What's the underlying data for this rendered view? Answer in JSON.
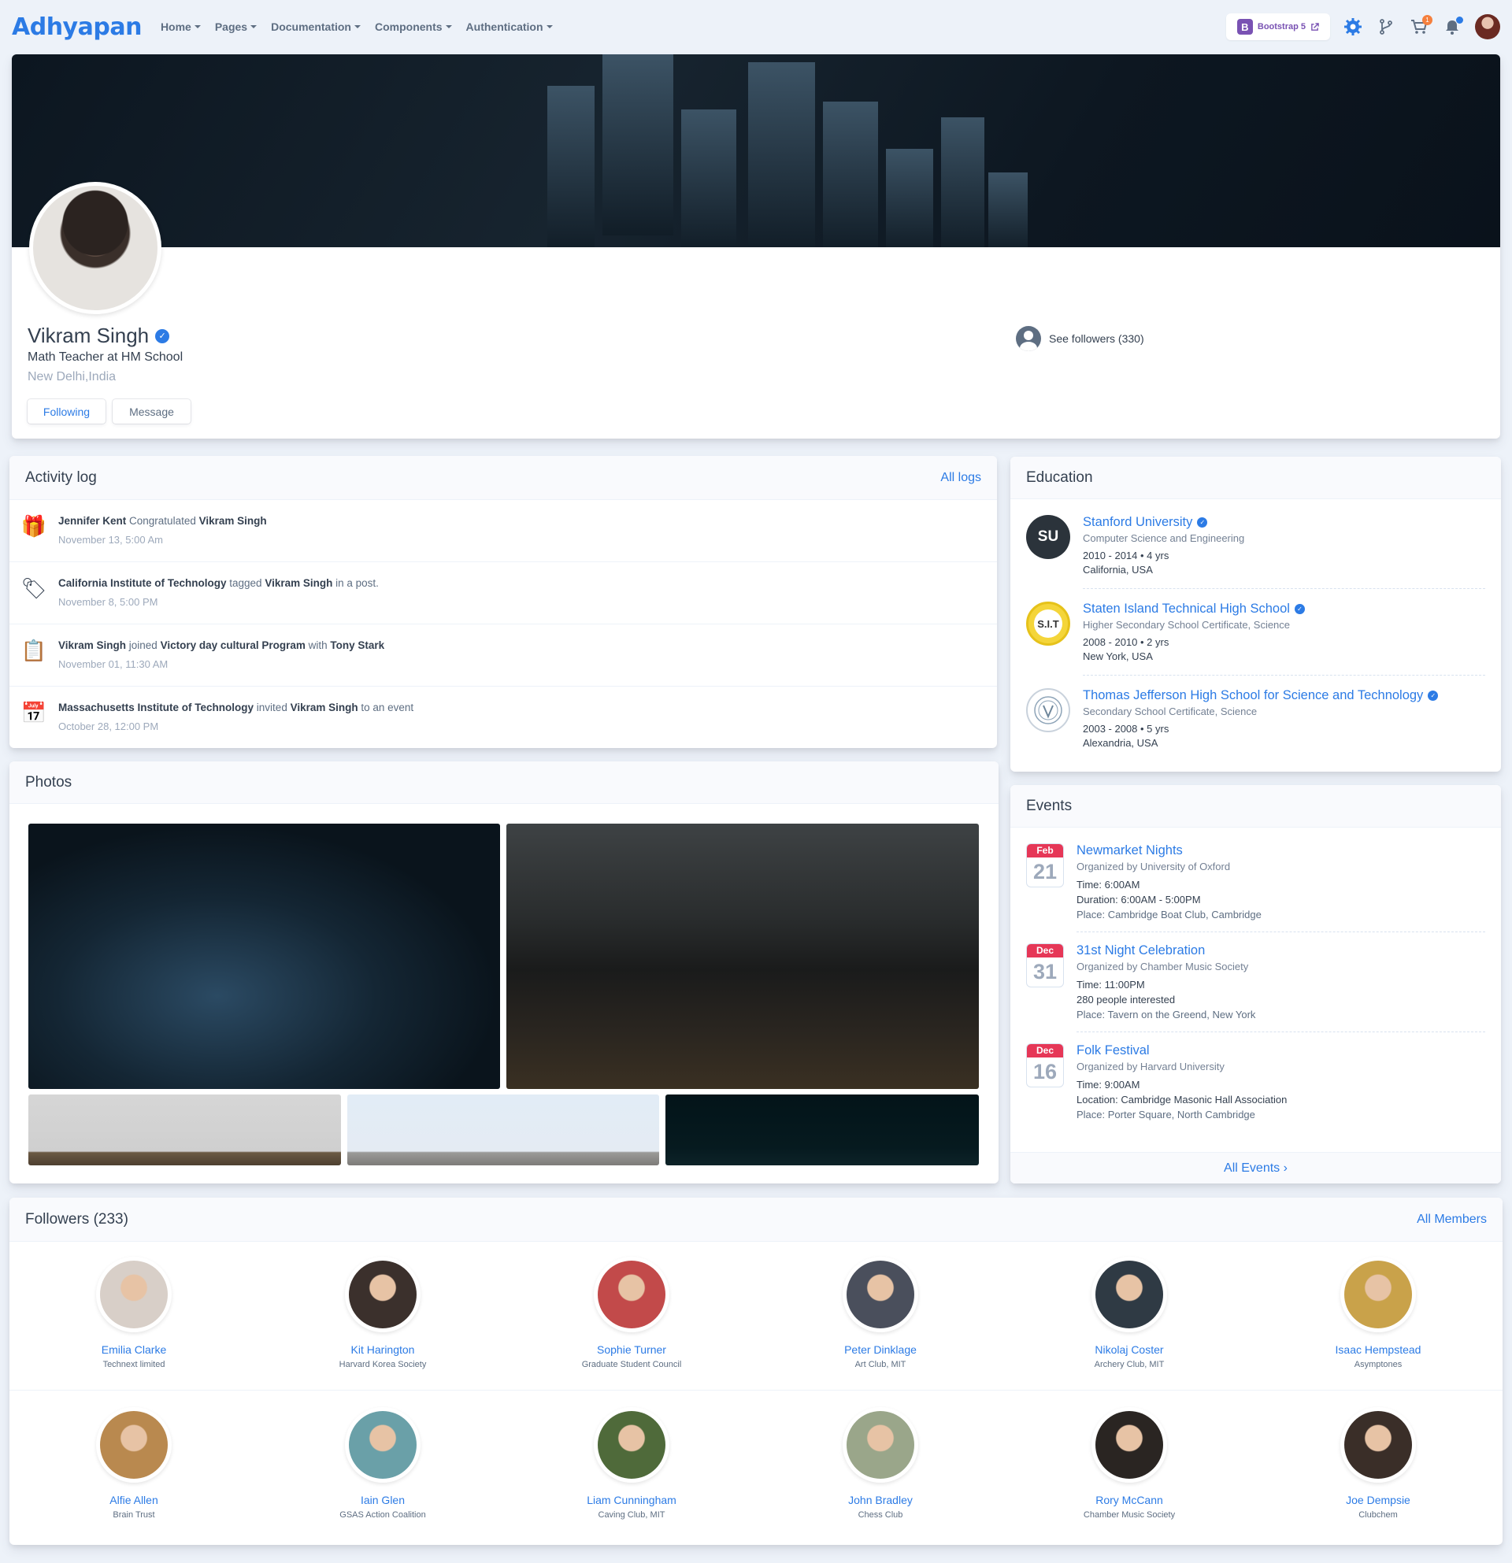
{
  "navbar": {
    "brand": "Adhyapan",
    "menu": [
      "Home",
      "Pages",
      "Documentation",
      "Components",
      "Authentication"
    ],
    "bootstrap_badge": "Bootstrap 5",
    "cart_count": "1"
  },
  "profile": {
    "name": "Vikram Singh",
    "role": "Math Teacher at HM School",
    "location": "New Delhi,India",
    "following_label": "Following",
    "message_label": "Message",
    "followers_link": "See followers (330)"
  },
  "activity": {
    "title": "Activity log",
    "all_link": "All logs",
    "items": [
      {
        "icon": "gift-icon",
        "glyph": "🎁",
        "actor": "Jennifer Kent",
        "verb": " Congratulated ",
        "target": "Vikram Singh",
        "tail": "",
        "tail2": "",
        "tail3": "",
        "time": "November 13, 5:00 Am"
      },
      {
        "icon": "tag-icon",
        "glyph": "🏷",
        "actor": "California Institute of Technology",
        "verb": " tagged ",
        "target": "Vikram Singh",
        "tail": " in a post.",
        "tail2": "",
        "tail3": "",
        "time": "November 8, 5:00 PM"
      },
      {
        "icon": "clipboard-icon",
        "glyph": "📋",
        "actor": "Vikram Singh",
        "verb": " joined ",
        "target": "Victory day cultural Program",
        "tail": " with ",
        "tail2": "Tony Stark",
        "tail3": "",
        "time": "November 01, 11:30 AM"
      },
      {
        "icon": "calendar-icon",
        "glyph": "📅",
        "actor": "Massachusetts Institute of Technology",
        "verb": " invited ",
        "target": "Vikram Singh",
        "tail": " to an event",
        "tail2": "",
        "tail3": "",
        "time": "October 28, 12:00 PM"
      }
    ]
  },
  "photos": {
    "title": "Photos"
  },
  "education": {
    "title": "Education",
    "items": [
      {
        "logo": "SU",
        "name": "Stanford University",
        "field": "Computer Science and Engineering",
        "period": "2010 - 2014 • 4 yrs",
        "place": "California, USA"
      },
      {
        "logo": "S.I.T",
        "name": "Staten Island Technical High School",
        "field": "Higher Secondary School Certificate, Science",
        "period": "2008 - 2010 • 2 yrs",
        "place": "New York, USA"
      },
      {
        "logo": "",
        "name": "Thomas Jefferson High School for Science and Technology",
        "field": "Secondary School Certificate, Science",
        "period": "2003 - 2008 • 5 yrs",
        "place": "Alexandria, USA"
      }
    ]
  },
  "events": {
    "title": "Events",
    "all_link": "All Events ›",
    "items": [
      {
        "month": "Feb",
        "day": "21",
        "name": "Newmarket Nights",
        "org": "Organized by University of Oxford",
        "l1": "Time: 6:00AM",
        "l2": "Duration: 6:00AM - 5:00PM",
        "l3": "Place: Cambridge Boat Club, Cambridge"
      },
      {
        "month": "Dec",
        "day": "31",
        "name": "31st Night Celebration",
        "org": "Organized by Chamber Music Society",
        "l1": "Time: 11:00PM",
        "l2": "280 people interested",
        "l3": "Place: Tavern on the Greend, New York"
      },
      {
        "month": "Dec",
        "day": "16",
        "name": "Folk Festival",
        "org": "Organized by Harvard University",
        "l1": "Time: 9:00AM",
        "l2": "Location: Cambridge Masonic Hall Association",
        "l3": "Place: Porter Square, North Cambridge"
      }
    ]
  },
  "followers": {
    "title": "Followers (233)",
    "all_link": "All Members",
    "items": [
      {
        "name": "Emilia Clarke",
        "org": "Technext limited",
        "color": "#d8cfc8"
      },
      {
        "name": "Kit Harington",
        "org": "Harvard Korea Society",
        "color": "#3b302c"
      },
      {
        "name": "Sophie Turner",
        "org": "Graduate Student Council",
        "color": "#c24a4a"
      },
      {
        "name": "Peter Dinklage",
        "org": "Art Club, MIT",
        "color": "#4a4f5c"
      },
      {
        "name": "Nikolaj Coster",
        "org": "Archery Club, MIT",
        "color": "#2f3a44"
      },
      {
        "name": "Isaac Hempstead",
        "org": "Asymptones",
        "color": "#c9a24a"
      },
      {
        "name": "Alfie Allen",
        "org": "Brain Trust",
        "color": "#b9894f"
      },
      {
        "name": "Iain Glen",
        "org": "GSAS Action Coalition",
        "color": "#6aa0a8"
      },
      {
        "name": "Liam Cunningham",
        "org": "Caving Club, MIT",
        "color": "#4f6a3a"
      },
      {
        "name": "John Bradley",
        "org": "Chess Club",
        "color": "#9aa68a"
      },
      {
        "name": "Rory McCann",
        "org": "Chamber Music Society",
        "color": "#2a2522"
      },
      {
        "name": "Joe Dempsie",
        "org": "Clubchem",
        "color": "#3a2e28"
      }
    ]
  }
}
